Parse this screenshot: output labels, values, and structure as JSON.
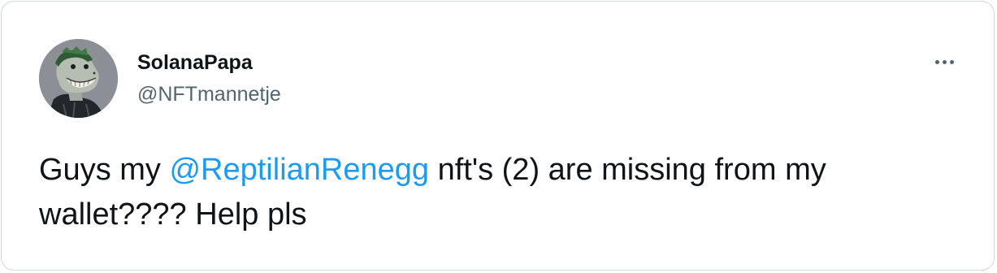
{
  "tweet": {
    "display_name": "SolanaPapa",
    "handle": "@NFTmannetje",
    "text_before": "Guys my ",
    "mention": "@ReptilianRenegg",
    "text_mid": " nft's (2) are missing from ",
    "text_after": "my wallet???? Help pls",
    "more_icon": "ellipsis-icon"
  },
  "colors": {
    "mention": "#1d9bf0",
    "name": "#0f1419",
    "handle": "#536471",
    "border": "#cfd9de"
  }
}
